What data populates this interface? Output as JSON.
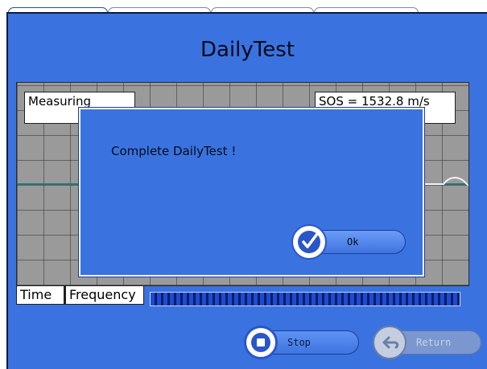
{
  "app": {
    "title": "DailyTest"
  },
  "tabs": [
    "",
    "",
    "",
    ""
  ],
  "graph": {
    "status_text": "Measuring",
    "sos_text": "SOS = 1532.8 m/s"
  },
  "view_tabs": {
    "time": "Time",
    "frequency": "Frequency"
  },
  "progress": {
    "fraction": 1.0
  },
  "buttons": {
    "stop": "Stop",
    "return": "Return"
  },
  "dialog": {
    "message": "Complete DailyTest !",
    "ok": "Ok"
  },
  "colors": {
    "background": "#3a73df",
    "graph": "#9a9a9a",
    "progress": "#1e4bd2"
  }
}
